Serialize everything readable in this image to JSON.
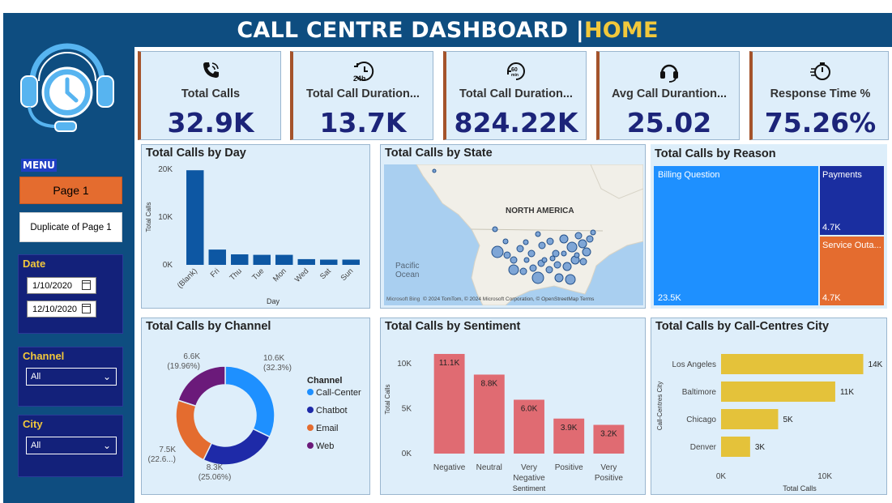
{
  "header": {
    "title": "CALL CENTRE DASHBOARD | ",
    "page": "HOME"
  },
  "sidebar": {
    "menu_label": "MENU",
    "pages": [
      "Page 1",
      "Duplicate of Page 1"
    ],
    "date": {
      "label": "Date",
      "start": "1/10/2020",
      "end": "12/10/2020"
    },
    "channel": {
      "label": "Channel",
      "value": "All"
    },
    "city": {
      "label": "City",
      "value": "All"
    }
  },
  "kpis": [
    {
      "icon": "phone-icon",
      "label": "Total Calls",
      "value": "32.9K"
    },
    {
      "icon": "clock-24h-icon",
      "label": "Total Call Duration...",
      "value": "13.7K"
    },
    {
      "icon": "timer-60min-icon",
      "label": "Total Call Duration...",
      "value": "824.22K"
    },
    {
      "icon": "headset-icon",
      "label": "Avg Call Durantion...",
      "value": "25.02"
    },
    {
      "icon": "stopwatch-icon",
      "label": "Response Time %",
      "value": "75.26%"
    }
  ],
  "colors": {
    "accent_orange": "#e46c2f",
    "navy": "#0e4d80",
    "bar_blue": "#0d57a3",
    "sentiment_red": "#e06b72",
    "city_gold": "#e4c23a"
  },
  "chart_data": [
    {
      "type": "bar",
      "title": "Total Calls by Day",
      "categories": [
        "(Blank)",
        "Fri",
        "Thu",
        "Tue",
        "Mon",
        "Wed",
        "Sat",
        "Sun"
      ],
      "values": [
        19800,
        3200,
        2200,
        2100,
        2100,
        1200,
        1100,
        1100
      ],
      "xlabel": "Day",
      "ylabel": "Total Calls",
      "yticks": [
        "0K",
        "10K",
        "20K"
      ],
      "ylim": [
        0,
        20000
      ]
    },
    {
      "type": "map",
      "title": "Total Calls by State",
      "labels": [
        "NORTH AMERICA",
        "Pacific Ocean"
      ],
      "attribution": "© 2024 TomTom, © 2024 Microsoft Corporation, © OpenStreetMap Terms",
      "brand": "Microsoft Bing"
    },
    {
      "type": "treemap",
      "title": "Total Calls by Reason",
      "items": [
        {
          "name": "Billing Question",
          "label": "23.5K",
          "value": 23500
        },
        {
          "name": "Payments",
          "label": "4.7K",
          "value": 4700
        },
        {
          "name": "Service Outa...",
          "label": "4.7K",
          "value": 4700
        }
      ]
    },
    {
      "type": "pie",
      "title": "Total Calls by Channel",
      "legend_title": "Channel",
      "slices": [
        {
          "name": "Call-Center",
          "value": 10600,
          "label": "10.6K",
          "pct": "(32.3%)",
          "color": "#1e90ff"
        },
        {
          "name": "Chatbot",
          "value": 8300,
          "label": "8.3K",
          "pct": "(25.06%)",
          "color": "#1e2aa8"
        },
        {
          "name": "Email",
          "value": 7500,
          "label": "7.5K",
          "pct": "(22.6...)",
          "color": "#e46c2f"
        },
        {
          "name": "Web",
          "value": 6600,
          "label": "6.6K",
          "pct": "(19.96%)",
          "color": "#6b1a7a"
        }
      ]
    },
    {
      "type": "bar",
      "title": "Total Calls by Sentiment",
      "categories": [
        "Negative",
        "Neutral",
        "Very Negative",
        "Positive",
        "Very Positive"
      ],
      "values": [
        11100,
        8800,
        6000,
        3900,
        3200
      ],
      "data_labels": [
        "11.1K",
        "8.8K",
        "6.0K",
        "3.9K",
        "3.2K"
      ],
      "xlabel": "Sentiment",
      "ylabel": "Total Calls",
      "yticks": [
        "0K",
        "5K",
        "10K"
      ],
      "ylim": [
        0,
        12000
      ]
    },
    {
      "type": "bar",
      "orientation": "horizontal",
      "title": "Total Calls by Call-Centres City",
      "categories": [
        "Los Angeles",
        "Baltimore",
        "Chicago",
        "Denver"
      ],
      "values": [
        13700,
        11000,
        5500,
        2800
      ],
      "data_labels": [
        "14K",
        "11K",
        "5K",
        "3K"
      ],
      "xlabel": "Total Calls",
      "ylabel": "Call-Centres City",
      "xticks": [
        "0K",
        "10K"
      ],
      "xlim": [
        0,
        16000
      ]
    }
  ]
}
